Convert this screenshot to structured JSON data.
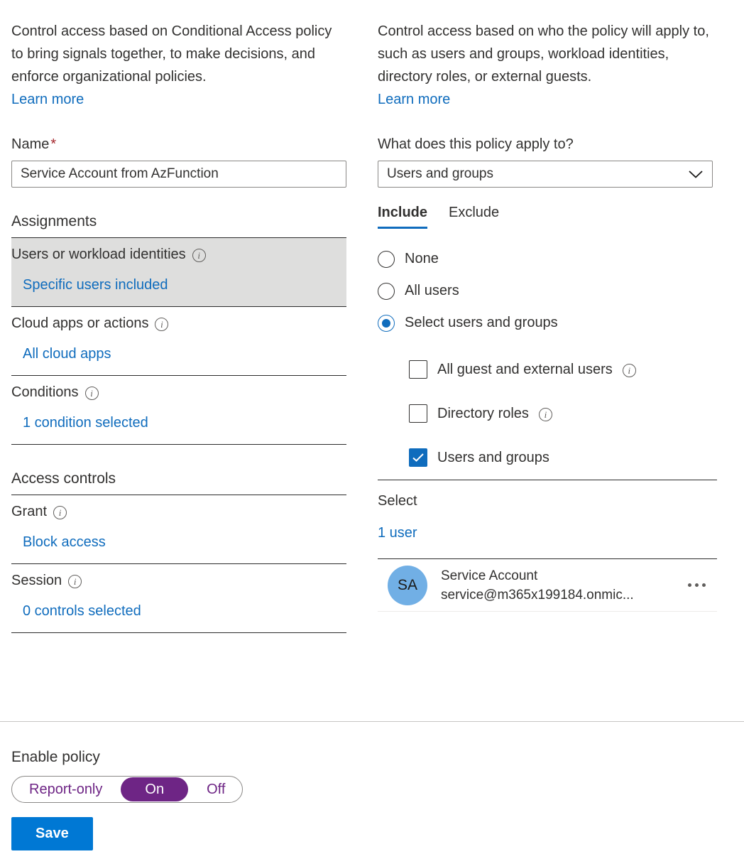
{
  "left": {
    "intro": "Control access based on Conditional Access policy to bring signals together, to make decisions, and enforce organizational policies.",
    "learn_more": "Learn more",
    "name_label": "Name",
    "name_required_mark": "*",
    "name_value": "Service Account from AzFunction",
    "name_placeholder": "",
    "assignments_heading": "Assignments",
    "access_controls_heading": "Access controls",
    "rows": [
      {
        "title": "Users or workload identities",
        "value": "Specific users included",
        "info": "info-icon",
        "selected": true
      },
      {
        "title": "Cloud apps or actions",
        "value": "All cloud apps",
        "info": "info-icon",
        "selected": false
      },
      {
        "title": "Conditions",
        "value": "1 condition selected",
        "info": "info-icon",
        "selected": false
      }
    ],
    "access_rows": [
      {
        "title": "Grant",
        "value": "Block access",
        "info": "info-icon",
        "selected": false
      },
      {
        "title": "Session",
        "value": "0 controls selected",
        "info": "info-icon",
        "selected": false
      }
    ]
  },
  "right": {
    "intro": "Control access based on who the policy will apply to, such as users and groups, workload identities, directory roles, or external guests.",
    "learn_more": "Learn more",
    "apply_to_label": "What does this policy apply to?",
    "apply_to_value": "Users and groups",
    "chevron": "chevron-down-icon",
    "tabs": [
      {
        "label": "Include",
        "active": true
      },
      {
        "label": "Exclude",
        "active": false
      }
    ],
    "radios": [
      {
        "label": "None",
        "checked": false
      },
      {
        "label": "All users",
        "checked": false
      },
      {
        "label": "Select users and groups",
        "checked": true
      }
    ],
    "checkboxes": [
      {
        "label": "All guest and external users",
        "checked": false,
        "info": "info-icon"
      },
      {
        "label": "Directory roles",
        "checked": false,
        "info": "info-icon"
      },
      {
        "label": "Users and groups",
        "checked": true,
        "info": null
      }
    ],
    "select_heading": "Select",
    "select_value": "1 user",
    "user": {
      "initials": "SA",
      "name": "Service Account",
      "email": "service@m365x199184.onmic...",
      "more": "more-options-icon"
    }
  },
  "bottom": {
    "enable_label": "Enable policy",
    "toggle_options": [
      {
        "label": "Report-only",
        "active": false
      },
      {
        "label": "On",
        "active": true
      },
      {
        "label": "Off",
        "active": false
      }
    ],
    "save_label": "Save"
  },
  "colors": {
    "link": "#0f6cbd",
    "accent": "#0078d4",
    "toggle_active": "#6e2585",
    "avatar": "#71afe5",
    "selected_row": "#dededd",
    "required": "#a4262c"
  }
}
